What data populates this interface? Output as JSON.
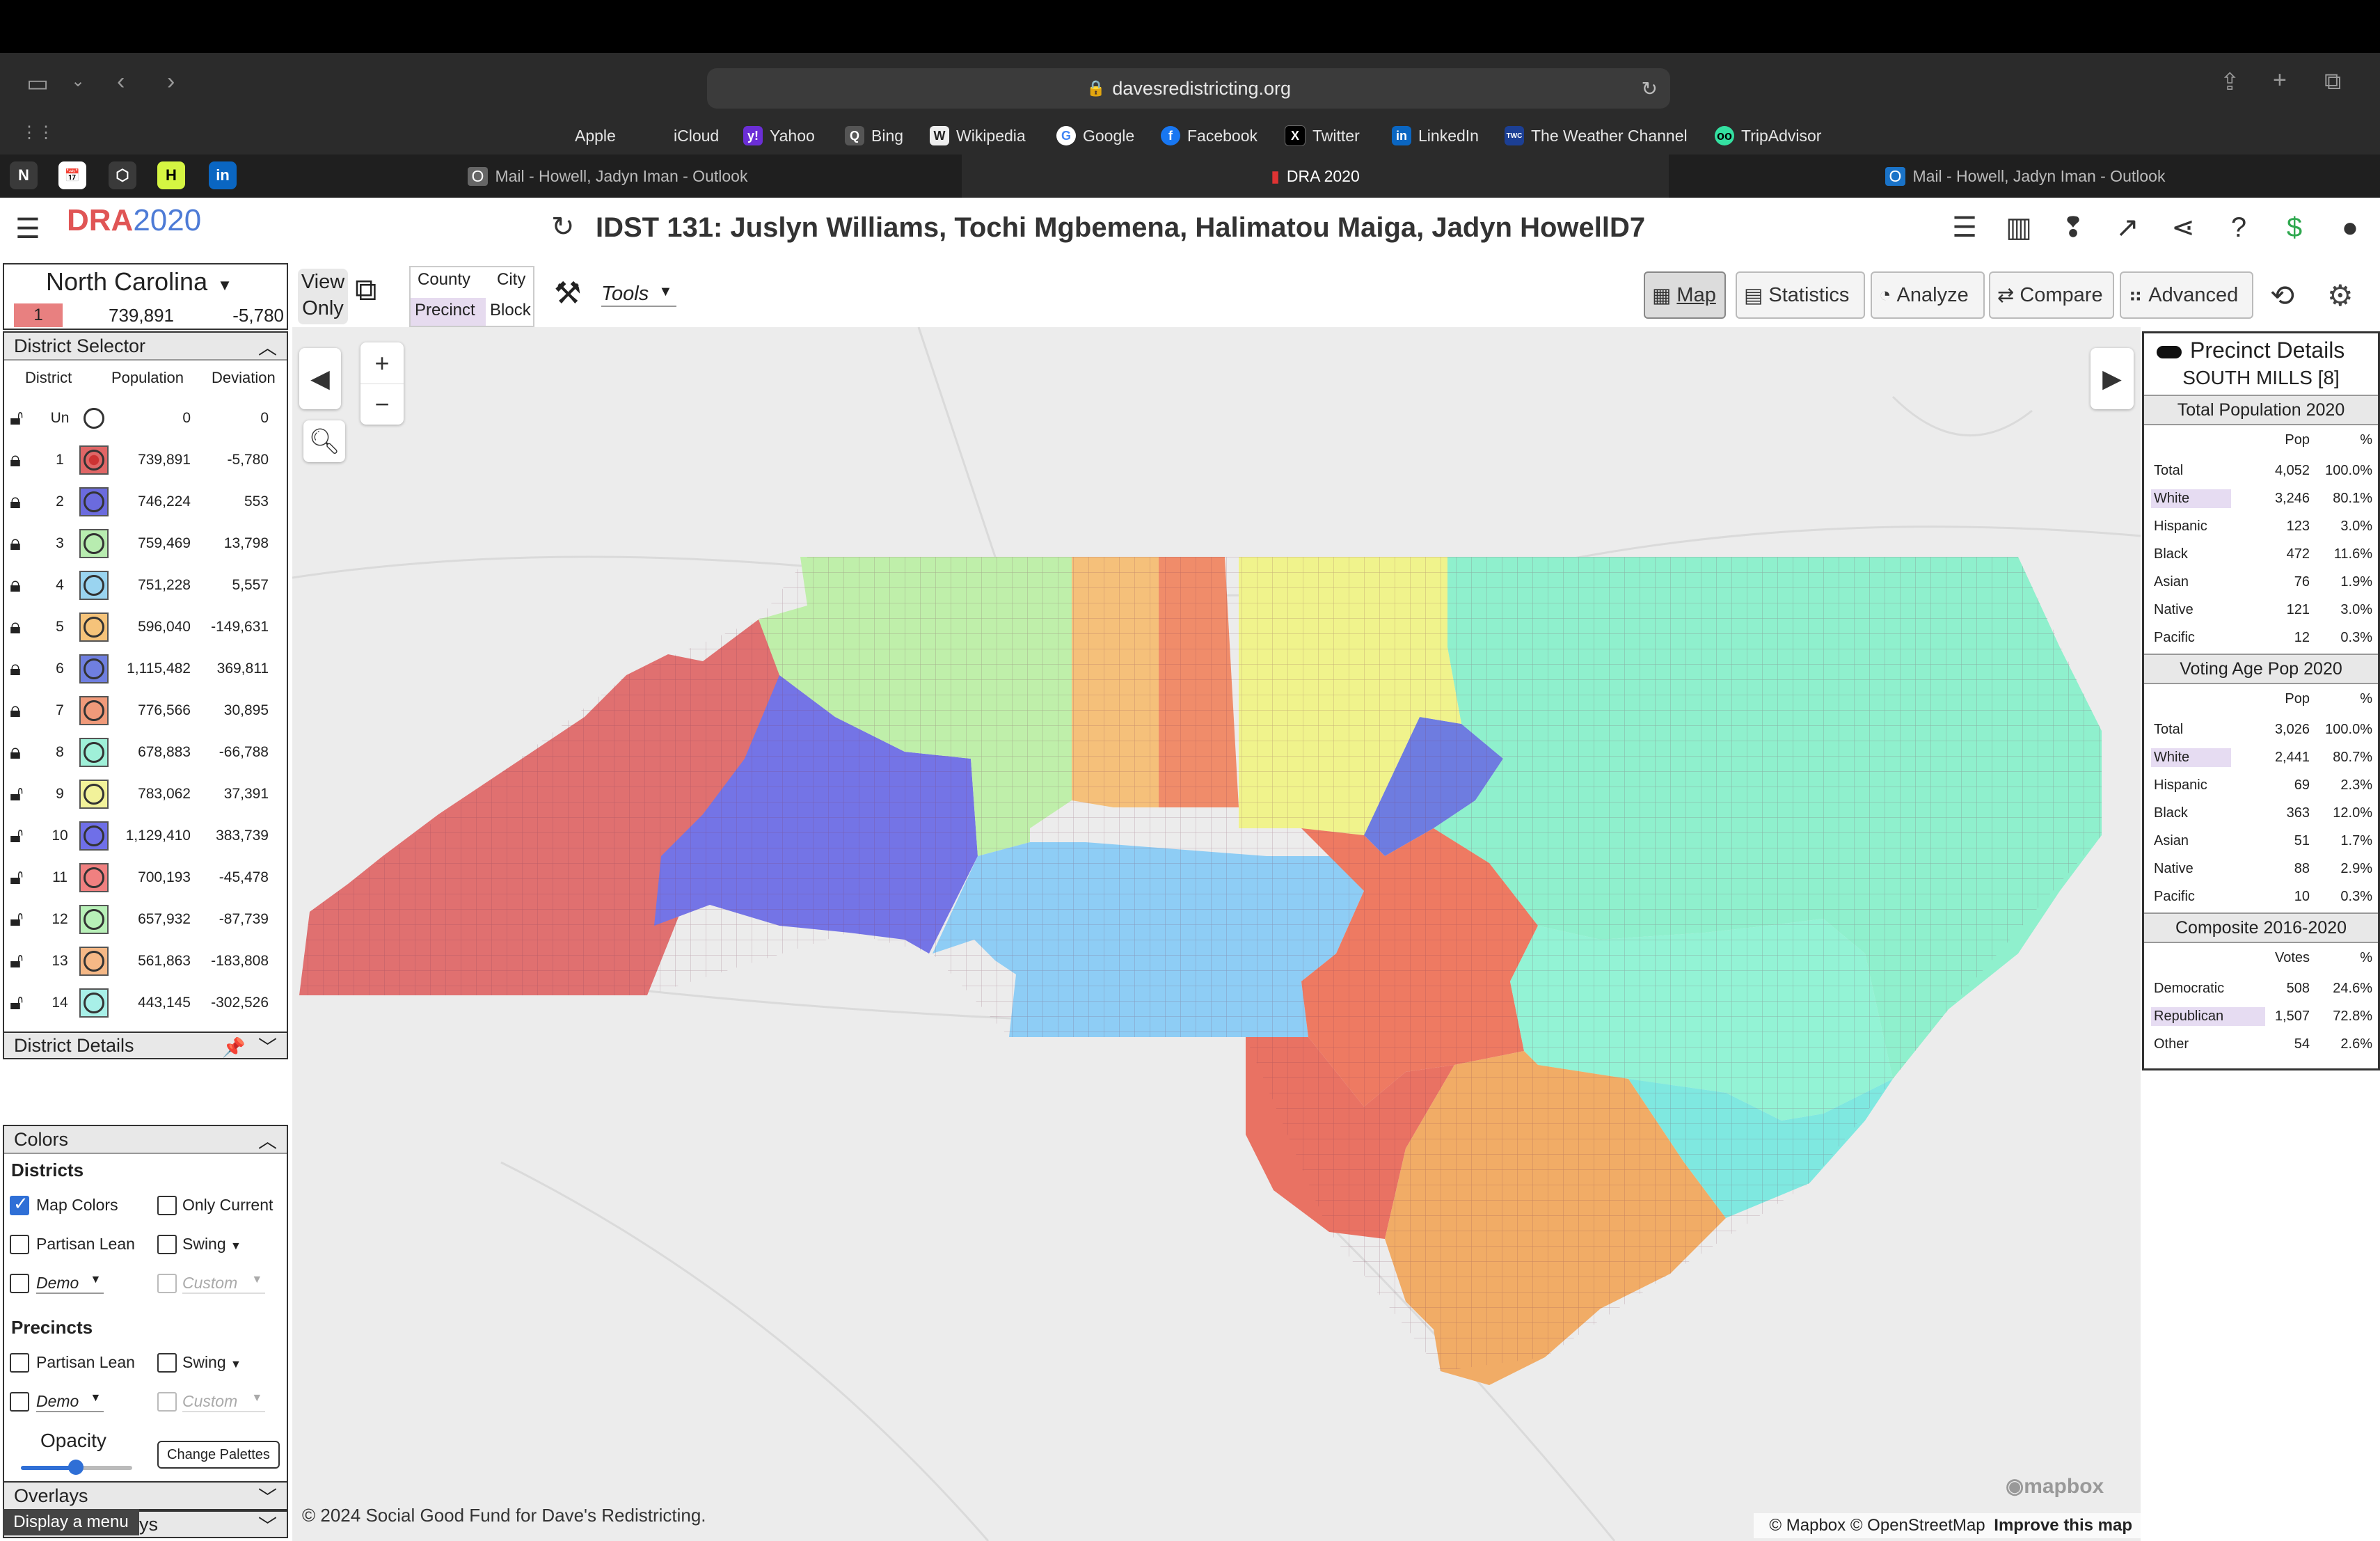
{
  "browser": {
    "url": "davesredistricting.org",
    "favorites": [
      "Apple",
      "iCloud",
      "Yahoo",
      "Bing",
      "Wikipedia",
      "Google",
      "Facebook",
      "Twitter",
      "LinkedIn",
      "The Weather Channel",
      "TripAdvisor"
    ],
    "tabs": [
      {
        "label": "Mail - Howell, Jadyn Iman - Outlook"
      },
      {
        "label": "DRA 2020"
      },
      {
        "label": "Mail - Howell, Jadyn Iman - Outlook"
      }
    ]
  },
  "app": {
    "logo_a": "DRA",
    "logo_b": "2020",
    "title": "IDST 131: Juslyn Williams, Tochi Mgbemena, Halimatou Maiga, Jadyn HowellD7"
  },
  "toolbar": {
    "view_only": [
      "View",
      "Only"
    ],
    "county": "County",
    "city": "City",
    "precinct": "Precinct",
    "block": "Block",
    "tools": "Tools",
    "modes": [
      "Map",
      "Statistics",
      "Analyze",
      "Compare",
      "Advanced"
    ]
  },
  "state_box": {
    "state": "North Carolina",
    "district": "1",
    "population": "739,891",
    "deviation": "-5,780"
  },
  "district_selector": {
    "title": "District Selector",
    "headers": [
      "District",
      "Population",
      "Deviation"
    ],
    "rows": [
      {
        "d": "Un",
        "pop": "0",
        "dev": "0",
        "color": "#ffffff",
        "locked": false
      },
      {
        "d": "1",
        "pop": "739,891",
        "dev": "-5,780",
        "color": "#e06666",
        "locked": true
      },
      {
        "d": "2",
        "pop": "746,224",
        "dev": "553",
        "color": "#6b6bde",
        "locked": true
      },
      {
        "d": "3",
        "pop": "759,469",
        "dev": "13,798",
        "color": "#b8ecb0",
        "locked": true
      },
      {
        "d": "4",
        "pop": "751,228",
        "dev": "5,557",
        "color": "#9ad4f0",
        "locked": true
      },
      {
        "d": "5",
        "pop": "596,040",
        "dev": "-149,631",
        "color": "#f5c37a",
        "locked": true
      },
      {
        "d": "6",
        "pop": "1,115,482",
        "dev": "369,811",
        "color": "#6f7fe0",
        "locked": true
      },
      {
        "d": "7",
        "pop": "776,566",
        "dev": "30,895",
        "color": "#f09a7a",
        "locked": true
      },
      {
        "d": "8",
        "pop": "678,883",
        "dev": "-66,788",
        "color": "#9ff0d8",
        "locked": true
      },
      {
        "d": "9",
        "pop": "783,062",
        "dev": "37,391",
        "color": "#f2f29a",
        "locked": false
      },
      {
        "d": "10",
        "pop": "1,129,410",
        "dev": "383,739",
        "color": "#6f6fe8",
        "locked": false
      },
      {
        "d": "11",
        "pop": "700,193",
        "dev": "-45,478",
        "color": "#f08080",
        "locked": false
      },
      {
        "d": "12",
        "pop": "657,932",
        "dev": "-87,739",
        "color": "#b8f0b8",
        "locked": false
      },
      {
        "d": "13",
        "pop": "561,863",
        "dev": "-183,808",
        "color": "#f5b886",
        "locked": false
      },
      {
        "d": "14",
        "pop": "443,145",
        "dev": "-302,526",
        "color": "#a8f0e8",
        "locked": false
      }
    ],
    "details": "District Details"
  },
  "colors_panel": {
    "title": "Colors",
    "districts_label": "Districts",
    "map_colors": "Map Colors",
    "only_current": "Only Current",
    "partisan_lean": "Partisan Lean",
    "swing": "Swing",
    "demo": "Demo",
    "custom": "Custom",
    "precincts_label": "Precincts",
    "opacity": "Opacity",
    "change_palettes": "Change Palettes",
    "overlays": "Overlays",
    "tooltip": "Display a menu",
    "last_partial": "ys"
  },
  "precinct_details": {
    "title": "Precinct Details",
    "name": "SOUTH MILLS [8]",
    "sections": [
      {
        "title": "Total Population 2020",
        "h1": "Pop",
        "h2": "%",
        "rows": [
          {
            "l": "Total",
            "v": "4,052",
            "p": "100.0%"
          },
          {
            "l": "White",
            "v": "3,246",
            "p": "80.1%",
            "hl": true
          },
          {
            "l": "Hispanic",
            "v": "123",
            "p": "3.0%"
          },
          {
            "l": "Black",
            "v": "472",
            "p": "11.6%"
          },
          {
            "l": "Asian",
            "v": "76",
            "p": "1.9%"
          },
          {
            "l": "Native",
            "v": "121",
            "p": "3.0%"
          },
          {
            "l": "Pacific",
            "v": "12",
            "p": "0.3%"
          }
        ]
      },
      {
        "title": "Voting Age Pop 2020",
        "h1": "Pop",
        "h2": "%",
        "rows": [
          {
            "l": "Total",
            "v": "3,026",
            "p": "100.0%"
          },
          {
            "l": "White",
            "v": "2,441",
            "p": "80.7%",
            "hl": true
          },
          {
            "l": "Hispanic",
            "v": "69",
            "p": "2.3%"
          },
          {
            "l": "Black",
            "v": "363",
            "p": "12.0%"
          },
          {
            "l": "Asian",
            "v": "51",
            "p": "1.7%"
          },
          {
            "l": "Native",
            "v": "88",
            "p": "2.9%"
          },
          {
            "l": "Pacific",
            "v": "10",
            "p": "0.3%"
          }
        ]
      },
      {
        "title": "Composite 2016-2020",
        "h1": "Votes",
        "h2": "%",
        "rows": [
          {
            "l": "Democratic",
            "v": "508",
            "p": "24.6%"
          },
          {
            "l": "Republican",
            "v": "1,507",
            "p": "72.8%",
            "hl": true
          },
          {
            "l": "Other",
            "v": "54",
            "p": "2.6%"
          }
        ]
      }
    ]
  },
  "map": {
    "copyright": "© 2024 Social Good Fund for Dave's Redistricting.",
    "attribution": "© Mapbox © OpenStreetMap",
    "improve": "Improve this map",
    "mapbox": "mapbox"
  }
}
